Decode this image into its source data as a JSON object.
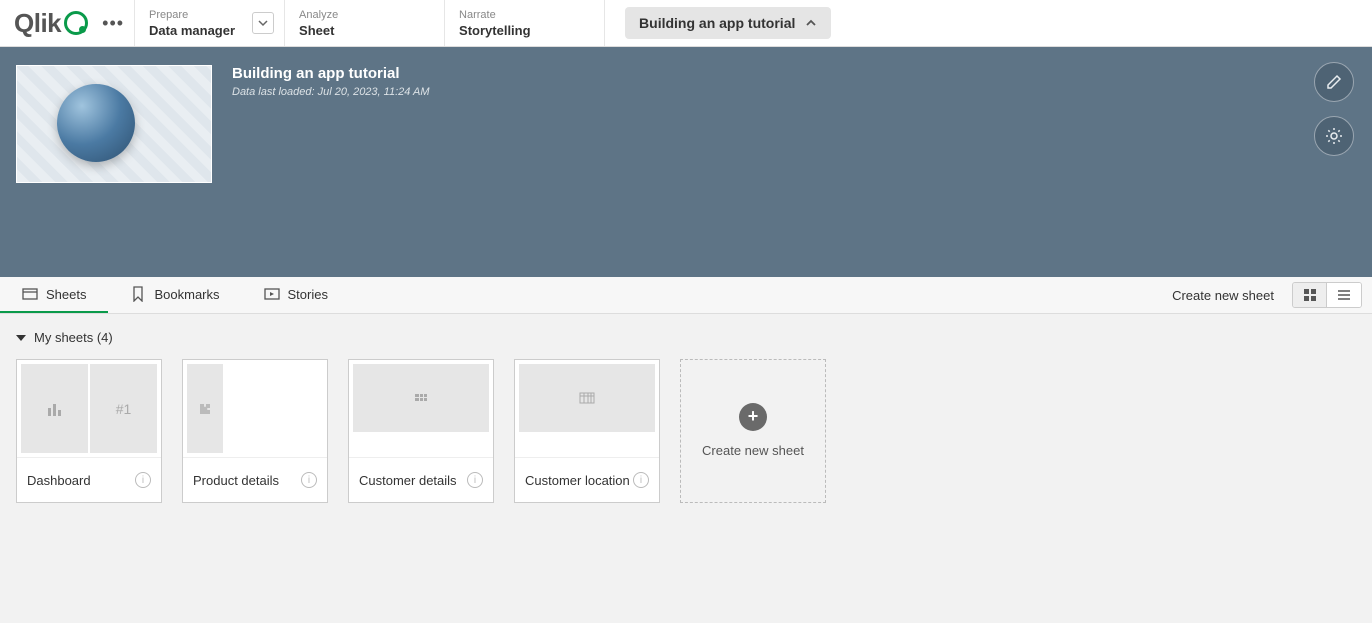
{
  "logo": {
    "text": "Qlik"
  },
  "topnav": {
    "prepare": {
      "category": "Prepare",
      "value": "Data manager"
    },
    "analyze": {
      "category": "Analyze",
      "value": "Sheet"
    },
    "narrate": {
      "category": "Narrate",
      "value": "Storytelling"
    },
    "tutorial_label": "Building an app tutorial"
  },
  "hero": {
    "title": "Building an app tutorial",
    "subtitle": "Data last loaded: Jul 20, 2023, 11:24 AM"
  },
  "tabs": {
    "sheets": "Sheets",
    "bookmarks": "Bookmarks",
    "stories": "Stories",
    "create_label": "Create new sheet"
  },
  "group": {
    "label": "My sheets (4)"
  },
  "sheets": [
    {
      "name": "Dashboard"
    },
    {
      "name": "Product details"
    },
    {
      "name": "Customer details"
    },
    {
      "name": "Customer location"
    }
  ],
  "create_card": {
    "label": "Create new sheet"
  },
  "preview_hash": "#1"
}
